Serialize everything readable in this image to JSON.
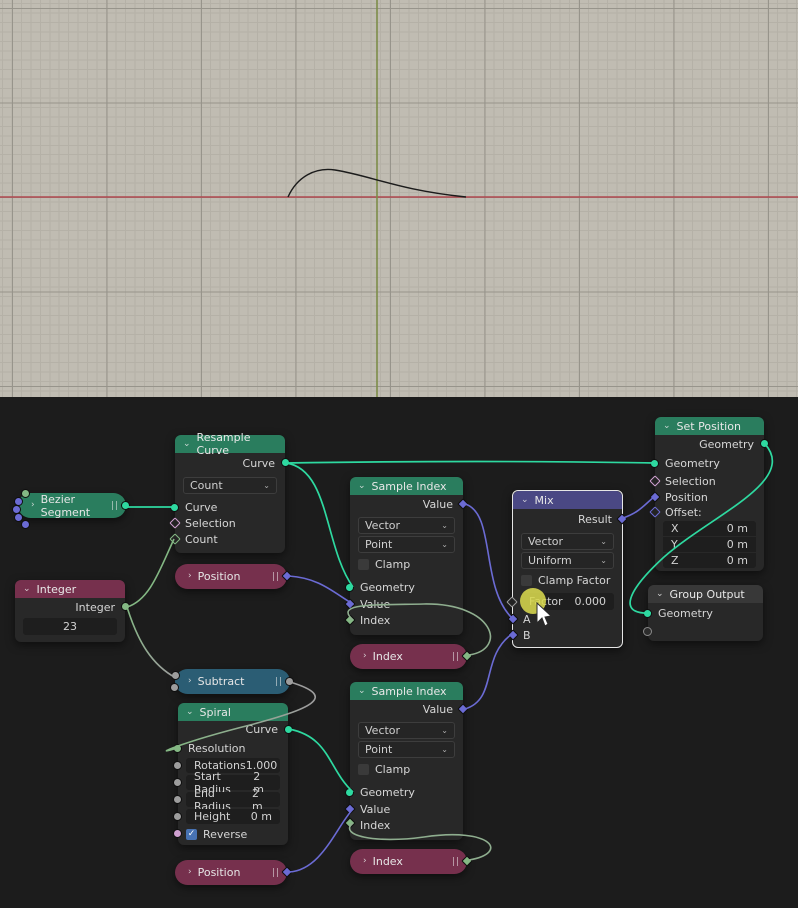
{
  "icons": {
    "collapse_chevron": "⌄",
    "pill_chevron": "›",
    "dropdown_chevron": "⌄",
    "checkmark": "✓"
  },
  "colors": {
    "header_geometry": "#2a7d5e",
    "header_input": "#76304d",
    "header_converter": "#2b5d74",
    "header_mix": "#4a4884",
    "header_output": "#383838",
    "socket_geometry": "#2ed9a0",
    "socket_vector": "#6b6bd4",
    "socket_boolean": "#cfa0d0",
    "socket_float": "#9d9d9d",
    "socket_integer": "#84b884",
    "viewport_background": "#c0bcb2",
    "axis_x": "#b0484f",
    "axis_y": "#7d8c49",
    "click_highlight": "#d8d84f"
  },
  "nodes": {
    "bezier_segment": {
      "title": "Bezier Segment"
    },
    "resample_curve": {
      "title": "Resample Curve",
      "output": "Curve",
      "mode": "Count",
      "inputs": [
        "Curve",
        "Selection",
        "Count"
      ]
    },
    "integer": {
      "title": "Integer",
      "output": "Integer",
      "value": "23"
    },
    "position_top": {
      "title": "Position"
    },
    "subtract": {
      "title": "Subtract"
    },
    "spiral": {
      "title": "Spiral",
      "output": "Curve",
      "resolution_label": "Resolution",
      "fields": [
        {
          "label": "Rotations",
          "value": "1.000"
        },
        {
          "label": "Start Radius",
          "value": "2 m"
        },
        {
          "label": "End Radius",
          "value": "2 m"
        },
        {
          "label": "Height",
          "value": "0 m"
        }
      ],
      "reverse_label": "Reverse"
    },
    "sample_index_top": {
      "title": "Sample Index",
      "output": "Value",
      "data_type": "Vector",
      "domain": "Point",
      "clamp_label": "Clamp",
      "inputs": [
        "Geometry",
        "Value",
        "Index"
      ]
    },
    "index_top": {
      "title": "Index"
    },
    "mix": {
      "title": "Mix",
      "output": "Result",
      "data_type": "Vector",
      "factor_mode": "Uniform",
      "clamp_label": "Clamp Factor",
      "factor_label": "Factor",
      "factor_value": "0.000",
      "input_a": "A",
      "input_b": "B"
    },
    "set_position": {
      "title": "Set Position",
      "output": "Geometry",
      "inputs": [
        "Geometry",
        "Selection",
        "Position",
        "Offset:"
      ],
      "offset_vector": [
        {
          "axis": "X",
          "value": "0 m"
        },
        {
          "axis": "Y",
          "value": "0 m"
        },
        {
          "axis": "Z",
          "value": "0 m"
        }
      ]
    },
    "group_output": {
      "title": "Group Output",
      "input": "Geometry"
    },
    "sample_index_bottom": {
      "title": "Sample Index",
      "output": "Value",
      "data_type": "Vector",
      "domain": "Point",
      "clamp_label": "Clamp",
      "inputs": [
        "Geometry",
        "Value",
        "Index"
      ]
    },
    "index_bottom": {
      "title": "Index"
    },
    "position_bottom": {
      "title": "Position"
    }
  }
}
